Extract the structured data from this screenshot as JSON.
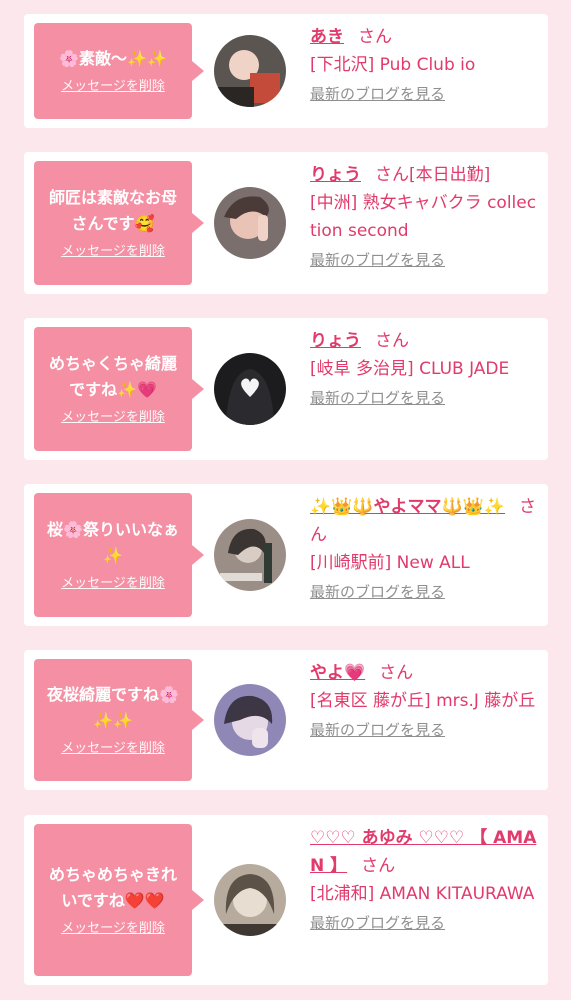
{
  "items": [
    {
      "message": "🌸素敵〜✨✨",
      "delete_label": "メッセージを削除",
      "name": "あき",
      "honorific": "さん",
      "status": "",
      "shop": "[下北沢] Pub Club io",
      "blog_link": "最新のブログを見る",
      "avatar_colors": [
        "#5a5550",
        "#c44a3a",
        "#2a2624"
      ]
    },
    {
      "message": "師匠は素敵なお母さんです🥰",
      "delete_label": "メッセージを削除",
      "name": "りょう",
      "honorific": "さん",
      "status": "[本日出勤]",
      "shop": "[中洲] 熟女キャバクラ collection second",
      "blog_link": "最新のブログを見る",
      "avatar_colors": [
        "#7a6f6d",
        "#e8c3b6",
        "#4a3a38"
      ]
    },
    {
      "message": "めちゃくちゃ綺麗ですね✨💗",
      "delete_label": "メッセージを削除",
      "name": "りょう",
      "honorific": "さん",
      "status": "",
      "shop": "[岐阜 多治見] CLUB JADE",
      "blog_link": "最新のブログを見る",
      "avatar_colors": [
        "#1c1c1e",
        "#f4f4f6",
        "#2b2a2e"
      ]
    },
    {
      "message": "桜🌸祭りいいなぁ✨",
      "delete_label": "メッセージを削除",
      "name": "✨👑🔱やよママ🔱👑✨",
      "honorific": "さん",
      "status": "",
      "shop": "[川崎駅前] New ALL",
      "blog_link": "最新のブログを見る",
      "avatar_colors": [
        "#9b8e86",
        "#d9ccc4",
        "#3a3432"
      ]
    },
    {
      "message": "夜桜綺麗ですね🌸✨✨",
      "delete_label": "メッセージを削除",
      "name": "やよ💗",
      "honorific": "さん",
      "status": "",
      "shop": "[名東区 藤が丘] mrs.J 藤が丘",
      "blog_link": "最新のブログを見る",
      "avatar_colors": [
        "#8f88b6",
        "#e6d9e6",
        "#3d3645"
      ]
    },
    {
      "message": "めちゃめちゃきれいですね❤️❤️",
      "delete_label": "メッセージを削除",
      "name": "♡♡♡ あゆみ ♡♡♡ 【 AMAN 】",
      "honorific": "さん",
      "status": "",
      "shop": "[北浦和] AMAN KITAURAWA",
      "blog_link": "最新のブログを見る",
      "avatar_colors": [
        "#b6ab9c",
        "#e7ded1",
        "#5c5248"
      ]
    }
  ]
}
